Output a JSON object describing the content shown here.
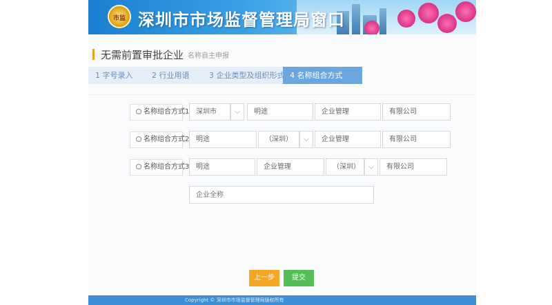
{
  "header": {
    "emblem_text": "市监",
    "title": "深圳市市场监督管理局窗口"
  },
  "page": {
    "title": "无需前置审批企业",
    "subtitle": "名称自主申报"
  },
  "steps": [
    {
      "label": "1 字号录入",
      "active": false
    },
    {
      "label": "2 行业用语",
      "active": false
    },
    {
      "label": "3 企业类型及组织形式",
      "active": false
    },
    {
      "label": "4 名称组合方式",
      "active": true
    }
  ],
  "options": [
    {
      "label": "名称组合方式1",
      "parts": [
        "深圳市",
        "明途",
        "企业管理",
        "有限公司"
      ]
    },
    {
      "label": "名称组合方式2",
      "parts": [
        "明途",
        "（深圳）",
        "企业管理",
        "有限公司"
      ]
    },
    {
      "label": "名称组合方式3",
      "parts": [
        "明途",
        "企业管理",
        "（深圳）",
        "有限公司"
      ]
    }
  ],
  "full_name_input": {
    "placeholder": "企业全称"
  },
  "buttons": {
    "prev": "上一步",
    "submit": "提交"
  },
  "footer": {
    "text": "Copyright © 深圳市市场监督管理局版权所有"
  },
  "colors": {
    "accent": "#6aa7de",
    "prev_button": "#f5a623",
    "submit_button": "#52be55",
    "footer": "#3b8fd6"
  }
}
